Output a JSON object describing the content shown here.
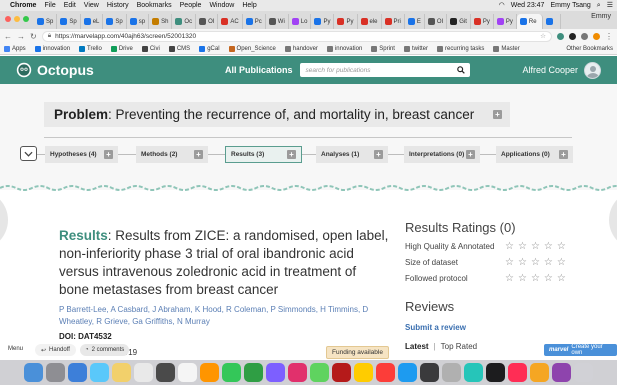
{
  "menubar": {
    "apple": "",
    "items": [
      "Chrome",
      "File",
      "Edit",
      "View",
      "History",
      "Bookmarks",
      "People",
      "Window",
      "Help"
    ],
    "clock": "Wed 23:47",
    "user": "Emmy Tsang"
  },
  "tabs": [
    {
      "label": "Sp",
      "color": "#1a73e8"
    },
    {
      "label": "Sp",
      "color": "#1a73e8"
    },
    {
      "label": "eL",
      "color": "#1a73e8"
    },
    {
      "label": "Sp",
      "color": "#1a73e8"
    },
    {
      "label": "sp",
      "color": "#1a73e8"
    },
    {
      "label": "Sh",
      "color": "#c47d00"
    },
    {
      "label": "Oc",
      "color": "#3e8e7e"
    },
    {
      "label": "OI",
      "color": "#555555"
    },
    {
      "label": "AC",
      "color": "#d93025"
    },
    {
      "label": "Pc",
      "color": "#1a73e8"
    },
    {
      "label": "Wi",
      "color": "#555555"
    },
    {
      "label": "Lo",
      "color": "#a142f4"
    },
    {
      "label": "Py",
      "color": "#1a73e8"
    },
    {
      "label": "Py",
      "color": "#d93025"
    },
    {
      "label": "ele",
      "color": "#d93025"
    },
    {
      "label": "Pri",
      "color": "#d93025"
    },
    {
      "label": "E",
      "color": "#1a73e8"
    },
    {
      "label": "OI",
      "color": "#555555"
    },
    {
      "label": "Git",
      "color": "#222222"
    },
    {
      "label": "Py",
      "color": "#d93025"
    },
    {
      "label": "Py",
      "color": "#a142f4"
    },
    {
      "label": "Re",
      "color": "#1a73e8"
    },
    {
      "label": "",
      "color": "#1a73e8"
    }
  ],
  "tab_user": "Emmy",
  "address": {
    "url": "https://marvelapp.com/40ajh63/screen/52001320"
  },
  "bookmarks": [
    {
      "label": "Apps",
      "color": "#4285f4"
    },
    {
      "label": "innovation",
      "color": "#1a73e8"
    },
    {
      "label": "Trello",
      "color": "#0079bf"
    },
    {
      "label": "Drive",
      "color": "#0f9d58"
    },
    {
      "label": "Civi",
      "color": "#444444"
    },
    {
      "label": "CMS",
      "color": "#444444"
    },
    {
      "label": "gCal",
      "color": "#1a73e8"
    },
    {
      "label": "Open_Science",
      "color": "#c4661f"
    },
    {
      "label": "handover",
      "color": "#777777"
    },
    {
      "label": "innovation",
      "color": "#777777"
    },
    {
      "label": "Sprint",
      "color": "#777777"
    },
    {
      "label": "twitter",
      "color": "#777777"
    },
    {
      "label": "recurring tasks",
      "color": "#777777"
    },
    {
      "label": "Master",
      "color": "#777777"
    }
  ],
  "bookmarks_other": "Other Bookmarks",
  "site": {
    "brand": "Octopus",
    "nav_all": "All Publications",
    "search_placeholder": "search for publications",
    "user_name": "Alfred Cooper",
    "accent": "#3e8e7e"
  },
  "problem": {
    "label": "Problem",
    "text": ": Preventing the recurrence of, and mortality in, breast cancer"
  },
  "stages": [
    {
      "label": "Hypotheses (4)"
    },
    {
      "label": "Methods (2)"
    },
    {
      "label": "Results (3)",
      "active": true
    },
    {
      "label": "Analyses (1)"
    },
    {
      "label": "Interpretations (0)"
    },
    {
      "label": "Applications (0)"
    }
  ],
  "result": {
    "label": "Results",
    "title": ": Results from ZICE: a randomised, open label, non-inferiority phase 3 trial of oral ibandronic acid versus intravenous zoledronic acid in treatment of bone metastases from breast cancer",
    "authors": "P Barrett-Lee, A Casbard, J Abraham, K Hood, R Coleman, P Simmonds, H Timmins, D Wheatley, R Grieve, Ga Griffiths, N Murray",
    "doi": "DOI: DAT4532",
    "date_fragment": "/19"
  },
  "ratings": {
    "title": "Results Ratings (0)",
    "criteria": [
      {
        "label": "High Quality & Annotated",
        "stars": 0,
        "max": 5
      },
      {
        "label": "Size of dataset",
        "stars": 0,
        "max": 5
      },
      {
        "label": "Followed protocol",
        "stars": 0,
        "max": 5
      }
    ]
  },
  "reviews": {
    "title": "Reviews",
    "submit": "Submit a review",
    "tab_latest": "Latest",
    "tab_top": "Top Rated"
  },
  "overlays": {
    "menu": "Menu",
    "handoff": "Handoff",
    "comments": "2 comments",
    "funding": "Funding available",
    "create_brand": "marvel",
    "create_label": "Create your own",
    "handoff_letter": "e"
  },
  "dock": [
    {
      "color": "#4a90d9"
    },
    {
      "color": "#8e8e93"
    },
    {
      "color": "#3d7fd9"
    },
    {
      "color": "#5ac8fa"
    },
    {
      "color": "#f2d06b"
    },
    {
      "color": "#e9e9e9"
    },
    {
      "color": "#4a4a4a"
    },
    {
      "color": "#f5f5f5"
    },
    {
      "color": "#ff9500"
    },
    {
      "color": "#34c759"
    },
    {
      "color": "#2f9e44"
    },
    {
      "color": "#7d5fff"
    },
    {
      "color": "#e1306c"
    },
    {
      "color": "#5fd35f"
    },
    {
      "color": "#b51a1a"
    },
    {
      "color": "#ffcc00"
    },
    {
      "color": "#fc3d39"
    },
    {
      "color": "#1d9bf0"
    },
    {
      "color": "#3a3a3c"
    },
    {
      "color": "#b0b0b0"
    },
    {
      "color": "#26c5b9"
    },
    {
      "color": "#1c1c1e"
    },
    {
      "color": "#ff2d55"
    },
    {
      "color": "#f5a623"
    },
    {
      "color": "#8e44ad"
    },
    {
      "color": "#d1d1d6"
    }
  ]
}
